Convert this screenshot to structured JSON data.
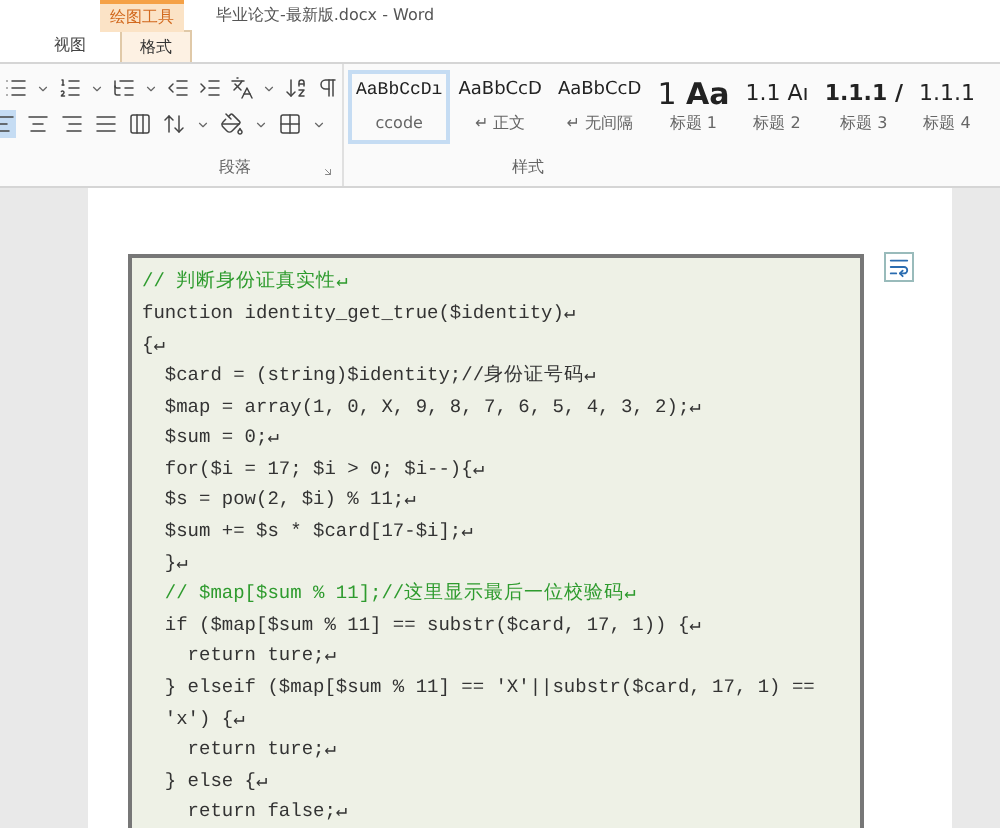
{
  "window": {
    "title": "毕业论文-最新版.docx - Word",
    "context_tab_group": "绘图工具"
  },
  "tabs": [
    {
      "label": "视图",
      "selected": false
    },
    {
      "label": "格式",
      "selected": true
    }
  ],
  "paragraph_group": {
    "label": "段落"
  },
  "styles_group": {
    "label": "样式",
    "items": [
      {
        "preview": "AaBbCcDı",
        "label": "ccode",
        "kind": "code",
        "selected": true
      },
      {
        "preview": "AaBbCcD",
        "label": "↵ 正文",
        "kind": "normal",
        "selected": false
      },
      {
        "preview": "AaBbCcD",
        "label": "↵ 无间隔",
        "kind": "normal",
        "selected": false
      },
      {
        "preview": "1 **Aa**",
        "label": "标题 1",
        "kind": "h1",
        "selected": false
      },
      {
        "preview": "1.1 Aı",
        "label": "标题 2",
        "kind": "h2",
        "selected": false
      },
      {
        "preview": "1.1.1 /",
        "label": "标题 3",
        "kind": "h3",
        "selected": false
      },
      {
        "preview": "1.1.1",
        "label": "标题 4",
        "kind": "h2",
        "selected": false
      }
    ]
  },
  "code_lines": [
    {
      "text": "// 判断身份证真实性↵",
      "kind": "comment"
    },
    {
      "text": "function identity_get_true($identity)↵",
      "kind": "code"
    },
    {
      "text": "{↵",
      "kind": "code"
    },
    {
      "text": "  $card = (string)$identity;//身份证号码↵",
      "kind": "code"
    },
    {
      "text": "  $map = array(1, 0, X, 9, 8, 7, 6, 5, 4, 3, 2);↵",
      "kind": "code"
    },
    {
      "text": "  $sum = 0;↵",
      "kind": "code"
    },
    {
      "text": "  for($i = 17; $i > 0; $i--){↵",
      "kind": "code"
    },
    {
      "text": "  $s = pow(2, $i) % 11;↵",
      "kind": "code"
    },
    {
      "text": "  $sum += $s * $card[17-$i];↵",
      "kind": "code"
    },
    {
      "text": "  }↵",
      "kind": "code"
    },
    {
      "text": "  // $map[$sum % 11];//这里显示最后一位校验码↵",
      "kind": "comment"
    },
    {
      "text": "  if ($map[$sum % 11] == substr($card, 17, 1)) {↵",
      "kind": "code"
    },
    {
      "text": "    return ture;↵",
      "kind": "code"
    },
    {
      "text": "  } elseif ($map[$sum % 11] == 'X'||substr($card, 17, 1) ==",
      "kind": "code"
    },
    {
      "text": "  'x') {↵",
      "kind": "code"
    },
    {
      "text": "    return ture;↵",
      "kind": "code"
    },
    {
      "text": "  } else {↵",
      "kind": "code"
    },
    {
      "text": "    return false;↵",
      "kind": "code"
    }
  ]
}
